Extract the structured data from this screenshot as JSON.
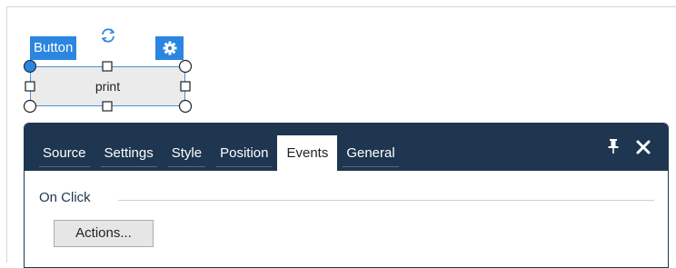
{
  "designer": {
    "object_type_label": "Button",
    "button_object_text": "print",
    "refresh_icon": "refresh-icon",
    "settings_icon": "gear-icon"
  },
  "panel": {
    "tabs": [
      {
        "label": "Source",
        "active": false
      },
      {
        "label": "Settings",
        "active": false
      },
      {
        "label": "Style",
        "active": false
      },
      {
        "label": "Position",
        "active": false
      },
      {
        "label": "Events",
        "active": true
      },
      {
        "label": "General",
        "active": false
      }
    ],
    "pin_icon": "pin-icon",
    "close_icon": "close-icon",
    "section_title": "On Click",
    "actions_button_label": "Actions..."
  },
  "colors": {
    "accent": "#2b86e0",
    "panel_header": "#1e3650",
    "selection": "#4a90d9"
  }
}
